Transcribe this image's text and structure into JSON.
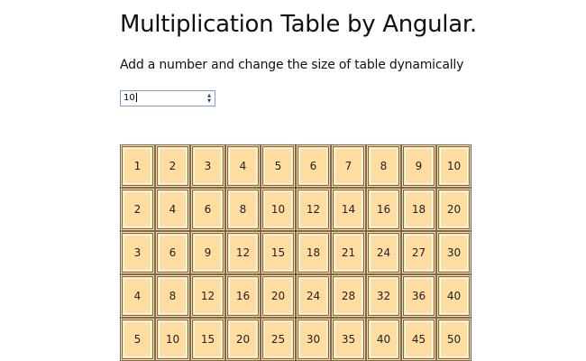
{
  "header": {
    "title": "Multiplication Table by Angular.",
    "subtitle": "Add a number and change the size of table dynamically"
  },
  "input": {
    "value": "10"
  },
  "table": {
    "size": 10,
    "visible_rows": [
      [
        "1",
        "2",
        "3",
        "4",
        "5",
        "6",
        "7",
        "8",
        "9",
        "10"
      ],
      [
        "2",
        "4",
        "6",
        "8",
        "10",
        "12",
        "14",
        "16",
        "18",
        "20"
      ],
      [
        "3",
        "6",
        "9",
        "12",
        "15",
        "18",
        "21",
        "24",
        "27",
        "30"
      ],
      [
        "4",
        "8",
        "12",
        "16",
        "20",
        "24",
        "28",
        "32",
        "36",
        "40"
      ],
      [
        "5",
        "10",
        "15",
        "20",
        "25",
        "30",
        "35",
        "40",
        "45",
        "50"
      ]
    ]
  },
  "colors": {
    "cell_background": "#ffdda0",
    "cell_border": "#7a6a55",
    "input_border": "#7a9cd3"
  },
  "icons": {
    "spinner": "up-down-arrows-icon"
  }
}
